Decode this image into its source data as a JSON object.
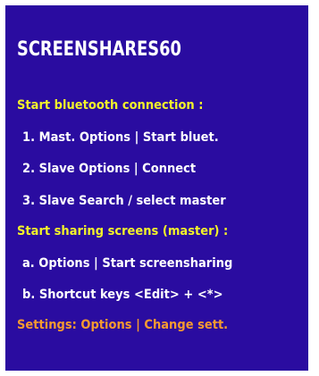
{
  "app": {
    "title": "SCREENSHARES60"
  },
  "bluetooth": {
    "heading": "Start bluetooth connection :",
    "steps": [
      "1. Mast.  Options | Start bluet.",
      "2. Slave  Options | Connect",
      "3. Slave  Search / select master"
    ]
  },
  "sharing": {
    "heading": "Start sharing screens (master) :",
    "steps": [
      "a. Options | Start screensharing",
      "b. Shortcut keys <Edit> +  <*>"
    ]
  },
  "settings": {
    "text": "Settings: Options | Change sett."
  },
  "colors": {
    "background": "#2a0ca0",
    "title": "#ffffff",
    "heading": "#f2f22a",
    "steps": "#ffffff",
    "settings": "#f59a30"
  }
}
